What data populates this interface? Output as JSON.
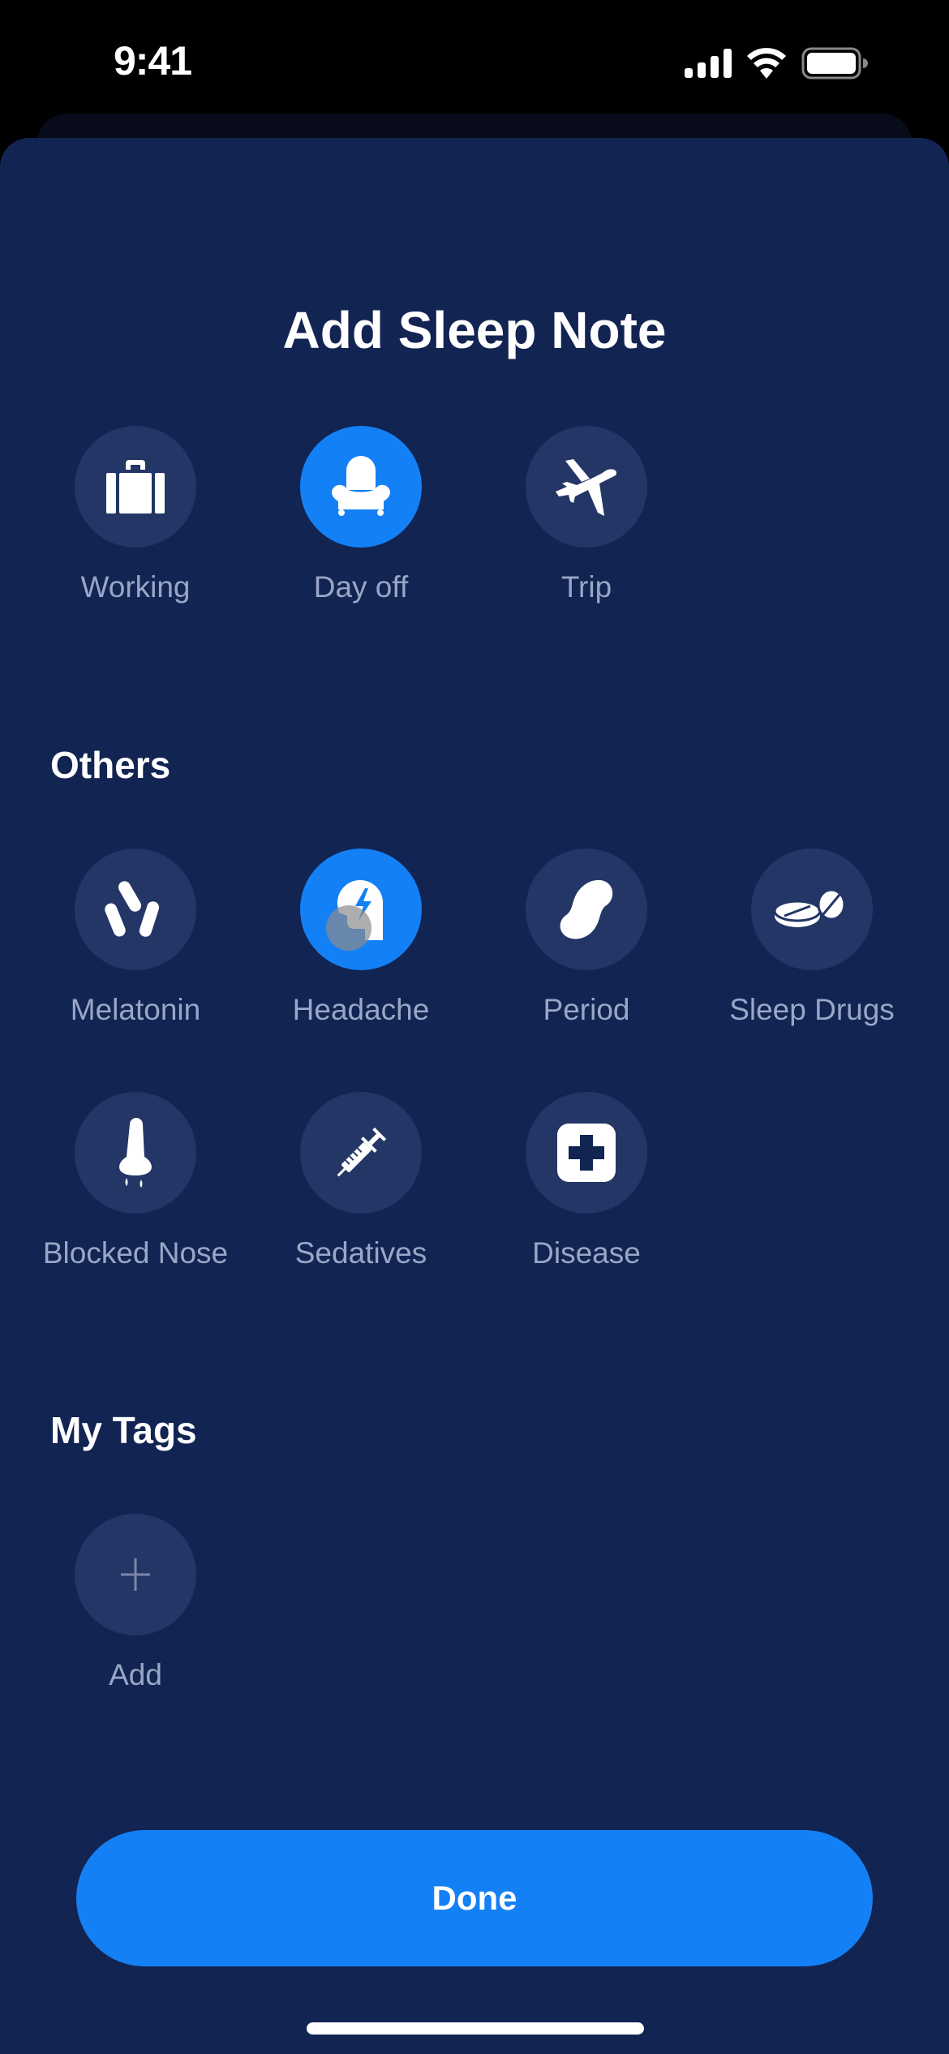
{
  "status_bar": {
    "time": "9:41",
    "icons": [
      "cellular-signal-icon",
      "wifi-icon",
      "battery-icon"
    ]
  },
  "sheet": {
    "title": "Add Sleep Note",
    "primary_tags": [
      {
        "label": "Working",
        "icon": "briefcase-icon",
        "selected": false
      },
      {
        "label": "Day off",
        "icon": "armchair-icon",
        "selected": true
      },
      {
        "label": "Trip",
        "icon": "airplane-icon",
        "selected": false
      }
    ],
    "others": {
      "heading": "Others",
      "tags": [
        {
          "label": "Melatonin",
          "icon": "pills-icon",
          "selected": false
        },
        {
          "label": "Headache",
          "icon": "head-lightning-icon",
          "selected": true
        },
        {
          "label": "Period",
          "icon": "pad-icon",
          "selected": false
        },
        {
          "label": "Sleep Drugs",
          "icon": "tablets-icon",
          "selected": false
        },
        {
          "label": "Blocked Nose",
          "icon": "nose-icon",
          "selected": false
        },
        {
          "label": "Sedatives",
          "icon": "syringe-icon",
          "selected": false
        },
        {
          "label": "Disease",
          "icon": "medical-cross-icon",
          "selected": false
        }
      ]
    },
    "my_tags": {
      "heading": "My Tags",
      "add_label": "Add",
      "add_icon": "plus-icon"
    },
    "done_label": "Done"
  },
  "colors": {
    "background": "#000000",
    "sheet": "#122452",
    "tag_circle": "#233666",
    "accent": "#1480f5",
    "label": "#9aa6c7"
  }
}
